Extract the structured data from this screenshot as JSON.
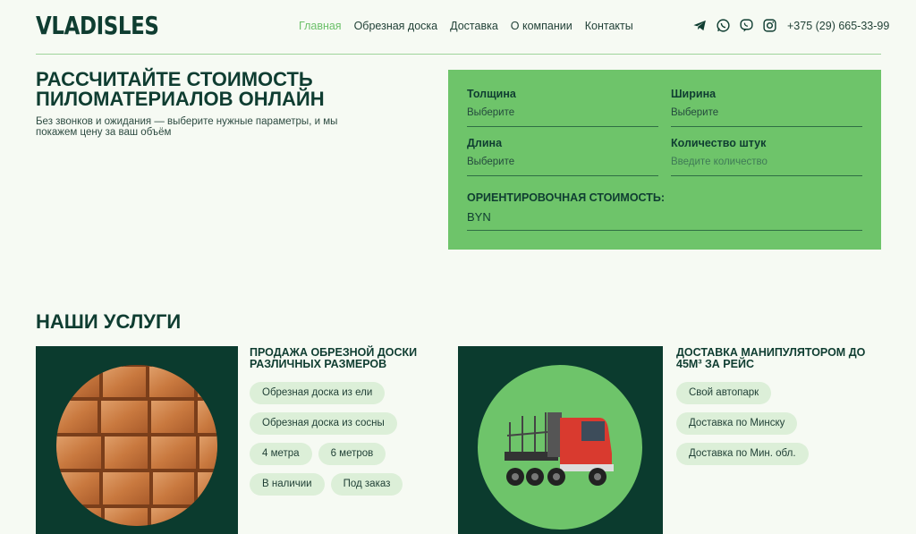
{
  "header": {
    "logo": "VLADISLES",
    "nav": [
      "Главная",
      "Обрезная доска",
      "Доставка",
      "О компании",
      "Контакты"
    ],
    "active_index": 0,
    "social_icons": [
      "telegram-icon",
      "whatsapp-icon",
      "viber-icon",
      "instagram-icon"
    ],
    "phone": "+375 (29) 665-33-99"
  },
  "hero": {
    "title": "Рассчитайте стоимость пиломатериалов онлайн",
    "subtitle": "Без звонков и ожидания — выберите нужные параметры, и мы покажем цену за ваш объём"
  },
  "calculator": {
    "thickness": {
      "label": "Толщина",
      "value": "Выберите"
    },
    "width": {
      "label": "Ширина",
      "value": "Выберите"
    },
    "length": {
      "label": "Длина",
      "value": "Выберите"
    },
    "quantity": {
      "label": "Количество штук",
      "placeholder": "Введите количество"
    },
    "cost_label": "ОРИЕНТИРОВОЧНАЯ СТОИМОСТЬ:",
    "cost_value": "BYN"
  },
  "services": {
    "title": "НАШИ УСЛУГИ",
    "cards": [
      {
        "title": "Продажа обрезной доски различных размеров",
        "tags": [
          "Обрезная доска из ели",
          "Обрезная доска из сосны",
          "4 метра",
          "6 метров",
          "В наличии",
          "Под заказ"
        ]
      },
      {
        "title": "Доставка манипулятором до 45м³ за рейс",
        "tags": [
          "Свой автопарк",
          "Доставка по Минску",
          "Доставка по Мин. обл."
        ]
      }
    ]
  },
  "colors": {
    "accent_green": "#6ec46a",
    "dark_green": "#0b3b2e",
    "text_dark": "#0f3d31",
    "tag_bg": "#dcefd8"
  }
}
